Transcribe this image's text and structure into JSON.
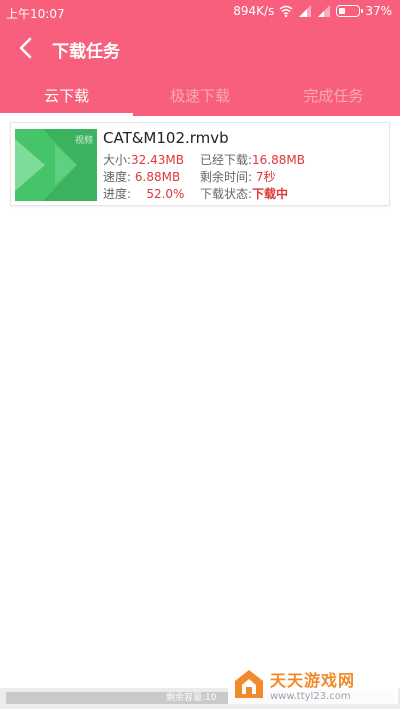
{
  "status_bar": {
    "time": "上午10:07",
    "speed": "894K/s",
    "battery": "37%",
    "battery_level": 0.37
  },
  "header": {
    "title": "下载任务"
  },
  "tabs": [
    {
      "label": "云下载",
      "active": true
    },
    {
      "label": "极速下载",
      "active": false
    },
    {
      "label": "完成任务",
      "active": false
    }
  ],
  "task": {
    "thumb_tag": "视频",
    "filename": "CAT&M102.rmvb",
    "size_label": "大小:",
    "size": "32.43MB",
    "downloaded_label": "已经下载:",
    "downloaded": "16.88MB",
    "speed_label": "速度:",
    "speed": "6.88MB",
    "remaining_label": "剩余时间:",
    "remaining": "7秒",
    "progress_label": "进度:",
    "progress": "52.0%",
    "state_label": "下载状态:",
    "state": "下载中"
  },
  "footer": {
    "storage": "剩余容量:10"
  },
  "watermark": {
    "name": "天天游戏网",
    "url": "www.ttyl23.com"
  },
  "colors": {
    "brand": "#f75f7c",
    "value": "#e03838",
    "thumb": "#46c46a",
    "watermark": "#f08a2a"
  }
}
